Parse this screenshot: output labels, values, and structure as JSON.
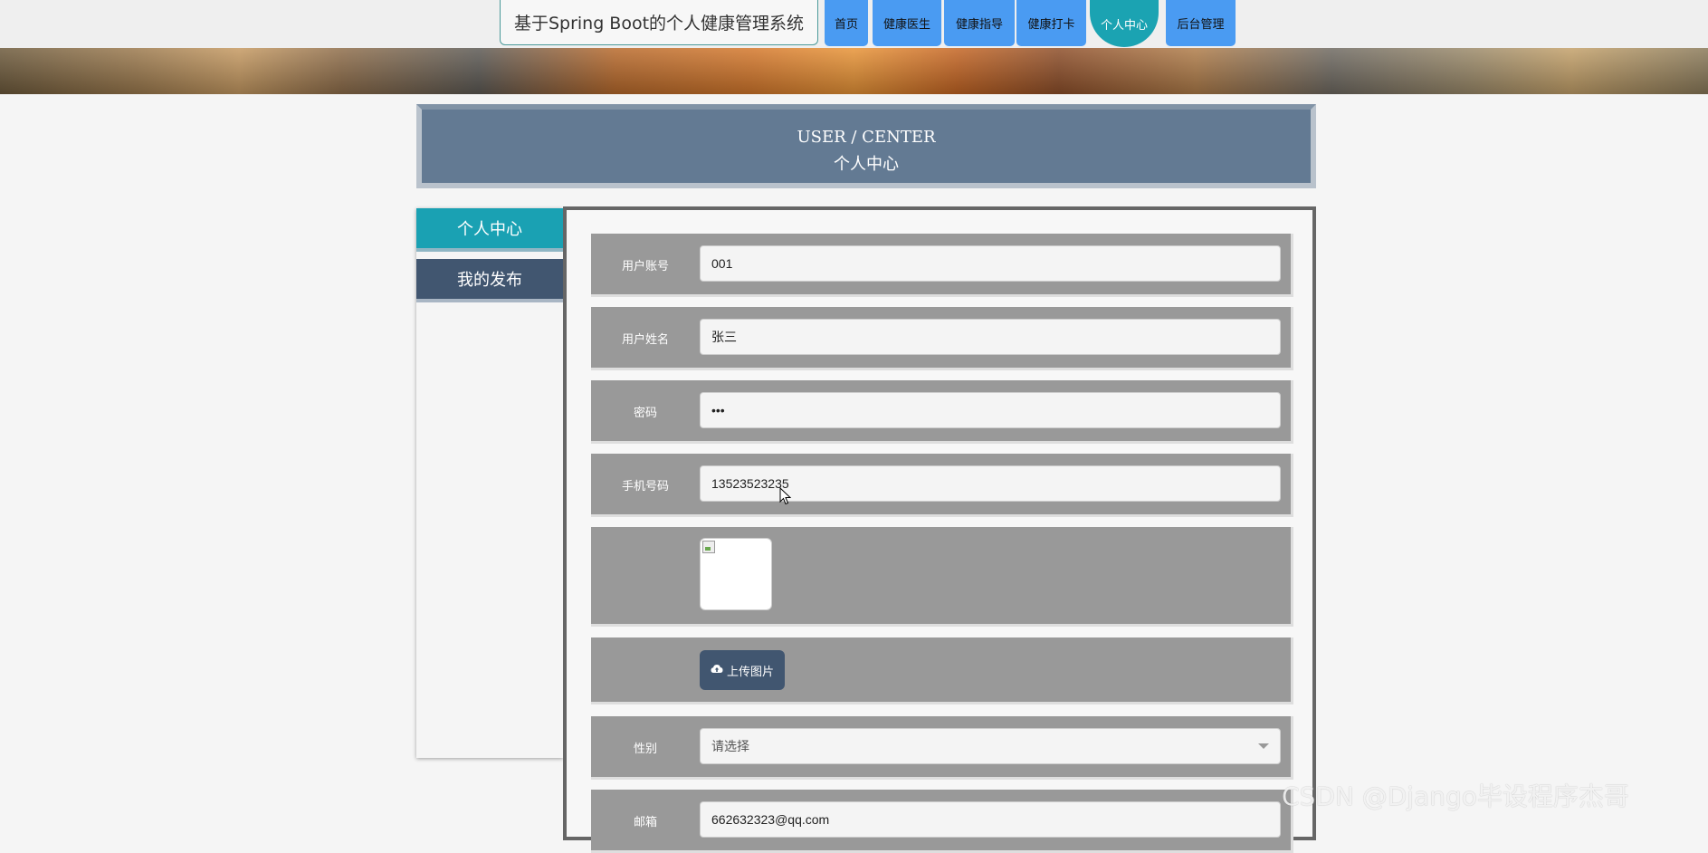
{
  "site": {
    "title": "基于Spring Boot的个人健康管理系统"
  },
  "nav": {
    "items": [
      {
        "label": "首页"
      },
      {
        "label": "健康医生"
      },
      {
        "label": "健康指导"
      },
      {
        "label": "健康打卡"
      },
      {
        "label": "个人中心"
      },
      {
        "label": "后台管理"
      }
    ],
    "active": "个人中心"
  },
  "header": {
    "en": "USER / CENTER",
    "zh": "个人中心"
  },
  "sidebar": {
    "items": [
      {
        "label": "个人中心"
      },
      {
        "label": "我的发布"
      }
    ],
    "active": "个人中心"
  },
  "form": {
    "account": {
      "label": "用户账号",
      "value": "001"
    },
    "name": {
      "label": "用户姓名",
      "value": "张三"
    },
    "password": {
      "label": "密码",
      "value": "•••"
    },
    "phone": {
      "label": "手机号码",
      "value": "13523523235"
    },
    "upload": {
      "label": "上传图片",
      "icon": "cloud-upload-icon"
    },
    "gender": {
      "label": "性别",
      "placeholder": "请选择"
    },
    "email": {
      "label": "邮箱",
      "value": "662632323@qq.com"
    }
  },
  "watermark": "CSDN @Django毕设程序杰哥",
  "colors": {
    "nav_blue": "#4a9bf2",
    "nav_active": "#1ba3b2",
    "header_bg": "#637a93",
    "sidebar_active": "#1aa1b3",
    "sidebar_item": "#415670",
    "row_bg": "#999999"
  }
}
